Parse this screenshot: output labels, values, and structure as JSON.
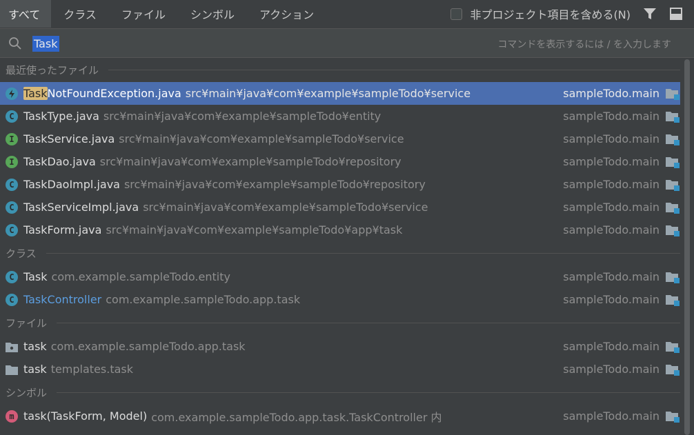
{
  "tabs": [
    {
      "label": "すべて"
    },
    {
      "label": "クラス"
    },
    {
      "label": "ファイル"
    },
    {
      "label": "シンボル"
    },
    {
      "label": "アクション"
    }
  ],
  "project_checkbox_label": "非プロジェクト項目を含める(N)",
  "project_checkbox_checked": false,
  "toolbar_icons": [
    "filter-icon",
    "preview-panel-icon"
  ],
  "search": {
    "value": "Task",
    "hint": "コマンドを表示するには / を入力します"
  },
  "sections": {
    "recent": "最近使ったファイル",
    "classes": "クラス",
    "files": "ファイル",
    "symbols": "シンボル"
  },
  "recent_files": [
    {
      "icon": "exception-class-icon",
      "match": "Task",
      "name": "NotFoundException.java",
      "path": "src¥main¥java¥com¥example¥sampleTodo¥service",
      "module": "sampleTodo.main",
      "selected": true
    },
    {
      "icon": "class-icon",
      "match": "",
      "name": "TaskType.java",
      "path": "src¥main¥java¥com¥example¥sampleTodo¥entity",
      "module": "sampleTodo.main"
    },
    {
      "icon": "interface-icon",
      "match": "",
      "name": "TaskService.java",
      "path": "src¥main¥java¥com¥example¥sampleTodo¥service",
      "module": "sampleTodo.main"
    },
    {
      "icon": "interface-icon",
      "match": "",
      "name": "TaskDao.java",
      "path": "src¥main¥java¥com¥example¥sampleTodo¥repository",
      "module": "sampleTodo.main"
    },
    {
      "icon": "class-icon",
      "match": "",
      "name": "TaskDaoImpl.java",
      "path": "src¥main¥java¥com¥example¥sampleTodo¥repository",
      "module": "sampleTodo.main"
    },
    {
      "icon": "class-icon",
      "match": "",
      "name": "TaskServiceImpl.java",
      "path": "src¥main¥java¥com¥example¥sampleTodo¥service",
      "module": "sampleTodo.main"
    },
    {
      "icon": "class-icon",
      "match": "",
      "name": "TaskForm.java",
      "path": "src¥main¥java¥com¥example¥sampleTodo¥app¥task",
      "module": "sampleTodo.main"
    }
  ],
  "classes": [
    {
      "icon": "class-icon",
      "name": "Task",
      "path": "com.example.sampleTodo.entity",
      "module": "sampleTodo.main",
      "blue": false
    },
    {
      "icon": "class-icon",
      "name": "TaskController",
      "path": "com.example.sampleTodo.app.task",
      "module": "sampleTodo.main",
      "blue": true
    }
  ],
  "files": [
    {
      "icon": "package-folder-icon",
      "name": "task",
      "path": "com.example.sampleTodo.app.task",
      "module": "sampleTodo.main"
    },
    {
      "icon": "folder-icon",
      "name": "task",
      "path": "templates.task",
      "module": "sampleTodo.main"
    }
  ],
  "symbols": [
    {
      "icon": "method-icon",
      "name": "task(TaskForm, Model)",
      "path": "com.example.sampleTodo.app.task.TaskController 内",
      "module": "sampleTodo.main"
    }
  ],
  "colors": {
    "background": "#3c3f41",
    "selection": "#4b6eaf",
    "match_highlight": "#d8b978",
    "class_icon": "#3d93b1",
    "interface_icon": "#58a658",
    "method_icon": "#d35b78"
  }
}
